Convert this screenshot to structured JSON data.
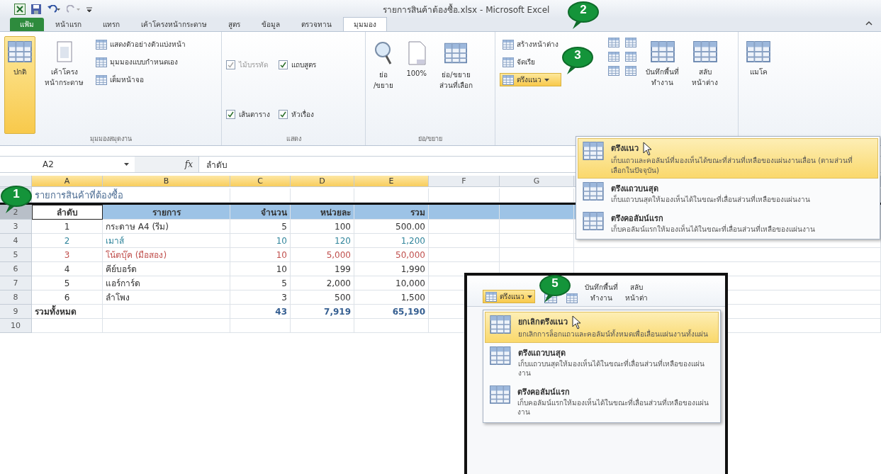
{
  "title_bar": {
    "title": "รายการสินค้าต้องซื้อ.xlsx - Microsoft Excel"
  },
  "ribbon_tabs": [
    {
      "label": "แฟ้ม",
      "kind": "file",
      "selected": false
    },
    {
      "label": "หน้าแรก",
      "kind": "tab",
      "selected": false
    },
    {
      "label": "แทรก",
      "kind": "tab",
      "selected": false
    },
    {
      "label": "เค้าโครงหน้ากระดาษ",
      "kind": "tab",
      "selected": false
    },
    {
      "label": "สูตร",
      "kind": "tab",
      "selected": false
    },
    {
      "label": "ข้อมูล",
      "kind": "tab",
      "selected": false
    },
    {
      "label": "ตรวจทาน",
      "kind": "tab",
      "selected": false
    },
    {
      "label": "มุมมอง",
      "kind": "tab",
      "selected": true
    }
  ],
  "ribbon": {
    "workbook_views": {
      "label": "มุมมองสมุดงาน",
      "large_buttons": [
        {
          "label": "ปกติ",
          "selected": true
        },
        {
          "label": "เค้าโครง\nหน้ากระดาษ",
          "selected": false
        }
      ],
      "small_buttons": [
        "แสดงตัวอย่างตัวแบ่งหน้า",
        "มุมมองแบบกำหนดเอง",
        "เต็มหน้าจอ"
      ]
    },
    "show": {
      "label": "แสดง",
      "checkboxes": [
        {
          "label": "ไม้บรรทัด",
          "checked": true,
          "disabled": true
        },
        {
          "label": "แถบสูตร",
          "checked": true,
          "disabled": false
        },
        {
          "label": "เส้นตาราง",
          "checked": true,
          "disabled": false
        },
        {
          "label": "หัวเรื่อง",
          "checked": true,
          "disabled": false
        }
      ]
    },
    "zoom": {
      "label": "ย่อ/ขยาย",
      "buttons": [
        "ย่อ\n/ขยาย",
        "100%",
        "ย่อ/ขยาย\nส่วนที่เลือก"
      ]
    },
    "window": {
      "new_window": "สร้างหน้าต่าง",
      "arrange": "จัดเรีย",
      "freeze": {
        "label": "ตรึงแนว",
        "selected": true
      },
      "save_workspace": "บันทึกพื้นที่\nทำงาน",
      "switch_windows": "สลับ\nหน้าต่าง"
    },
    "macros": {
      "label": "แมโค"
    }
  },
  "formula_bar": {
    "name_box": "A2",
    "function_label": "fx",
    "value": "ลำดับ"
  },
  "sheet": {
    "columns": [
      {
        "label": "A",
        "selected": true
      },
      {
        "label": "B",
        "selected": true
      },
      {
        "label": "C",
        "selected": true
      },
      {
        "label": "D",
        "selected": true
      },
      {
        "label": "E",
        "selected": true
      },
      {
        "label": "F",
        "selected": false
      },
      {
        "label": "G",
        "selected": false
      }
    ],
    "rows": [
      {
        "kind": "title",
        "cells": [
          "รายการสินค้าที่ต้องซื้อ"
        ]
      },
      {
        "number": "2",
        "kind": "header",
        "frozen": true,
        "first_cell_selected": true,
        "cells": [
          "ลำดับ",
          "รายการ",
          "จำนวน",
          "หน่วยละ",
          "รวม"
        ]
      },
      {
        "number": "3",
        "kind": "item",
        "cells": [
          "1",
          "กระดาษ   A4 (รีม)",
          "5",
          "100",
          "500.00"
        ]
      },
      {
        "number": "4",
        "kind": "item",
        "color": "#31859c",
        "cells": [
          "2",
          "เมาส์",
          "10",
          "120",
          "1,200"
        ]
      },
      {
        "number": "5",
        "kind": "item",
        "color": "#c0504d",
        "cells": [
          "3",
          "โน้ตบุ๊ค   (มือสอง)",
          "10",
          "5,000",
          "50,000"
        ]
      },
      {
        "number": "6",
        "kind": "item",
        "cells": [
          "4",
          "คีย์บอร์ด",
          "10",
          "199",
          "1,990"
        ]
      },
      {
        "number": "7",
        "kind": "item",
        "cells": [
          "5",
          "แอร์การ์ด",
          "5",
          "2,000",
          "10,000"
        ]
      },
      {
        "number": "8",
        "kind": "item",
        "cells": [
          "6",
          "ลำโพง",
          "3",
          "500",
          "1,500"
        ]
      },
      {
        "number": "9",
        "kind": "total",
        "color": "#376092",
        "cells": [
          "รวมทั้งหมด",
          "",
          "43",
          "7,919",
          "65,190"
        ]
      },
      {
        "number": "10",
        "kind": "item",
        "cells": []
      }
    ]
  },
  "freeze_menu": {
    "items": [
      {
        "title": "ตรึงแนว",
        "description": "เก็บแถวและคอลัมน์ที่มองเห็นได้ขณะที่ส่วนที่เหลือของแผ่นงานเลื่อน (ตามส่วนที่เลือกในปัจจุบัน)",
        "selected": true
      },
      {
        "title": "ตรึงแถวบนสุด",
        "description": "เก็บแถวบนสุดให้มองเห็นได้ในขณะที่เลื่อนส่วนที่เหลือของแผ่นงาน",
        "selected": false
      },
      {
        "title": "ตรึงคอลัมน์แรก",
        "description": "เก็บคอลัมน์แรกให้มองเห็นได้ในขณะที่เลื่อนส่วนที่เหลือของแผ่นงาน",
        "selected": false
      }
    ]
  },
  "inset": {
    "freeze": {
      "label": "ตรึงแนว",
      "selected": true
    },
    "save_workspace": "บันทึกพื้นที่\nทำงาน",
    "switch_windows": "สลับ\nหน้าต่า",
    "menu": {
      "items": [
        {
          "title": "ยกเลิกตรึงแนว",
          "description": "ยกเลิกการล็อกแถวและคอลัมน์ทั้งหมดเพื่อเลื่อนแผ่นงานทั้งแผ่น",
          "selected": true
        },
        {
          "title": "ตรึงแถวบนสุด",
          "description": "เก็บแถวบนสุดให้มองเห็นได้ในขณะที่เลื่อนส่วนที่เหลือของแผ่นงาน",
          "selected": false
        },
        {
          "title": "ตรึงคอลัมน์แรก",
          "description": "เก็บคอลัมน์แรกให้มองเห็นได้ในขณะที่เลื่อนส่วนที่เหลือของแผ่นงาน",
          "selected": false
        }
      ]
    }
  },
  "callouts": [
    {
      "number": "1"
    },
    {
      "number": "2"
    },
    {
      "number": "3"
    },
    {
      "number": "5"
    }
  ]
}
